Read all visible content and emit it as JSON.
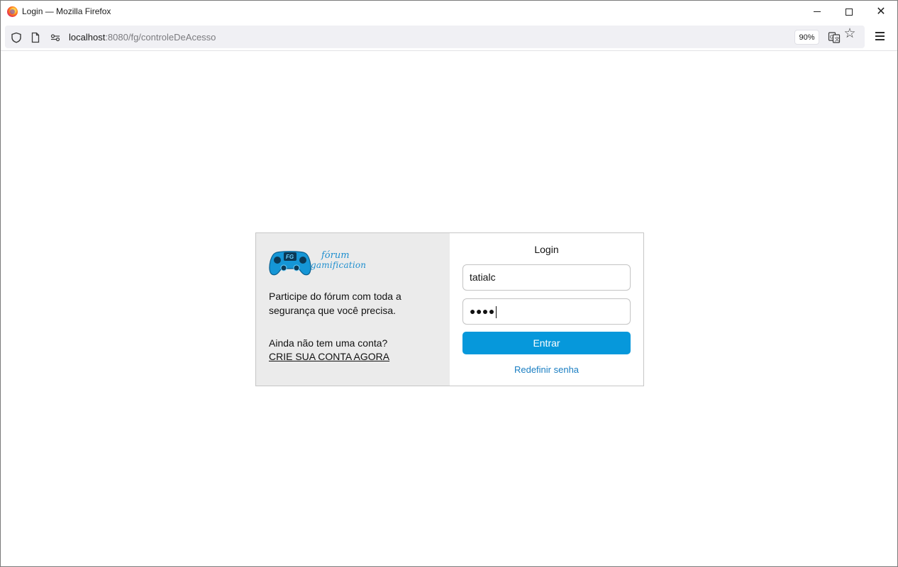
{
  "window": {
    "title": "Login — Mozilla Firefox",
    "icon": "firefox-logo-icon"
  },
  "navbar": {
    "url_host": "localhost",
    "url_rest": ":8080/fg/controleDeAcesso",
    "zoom": "90%",
    "icons": [
      "shield-icon",
      "page-icon",
      "permissions-icon",
      "translate-icon",
      "star-icon",
      "menu-icon"
    ]
  },
  "card": {
    "logo": {
      "line1": "fórum",
      "line2": "gamification",
      "badge": "FG"
    },
    "tagline": "Participe do fórum com toda a segurança que você precisa.",
    "no_account": "Ainda não tem uma conta?",
    "create_link": "CRIE SUA CONTA AGORA",
    "login_title": "Login",
    "username_value": "tatialc",
    "password_mask": "●●●●",
    "submit_label": "Entrar",
    "reset_link": "Redefinir senha"
  },
  "colors": {
    "accent": "#0698db",
    "link": "#1a7ec2",
    "left_panel": "#ebebeb",
    "logo_blue": "#1f8fcf"
  }
}
